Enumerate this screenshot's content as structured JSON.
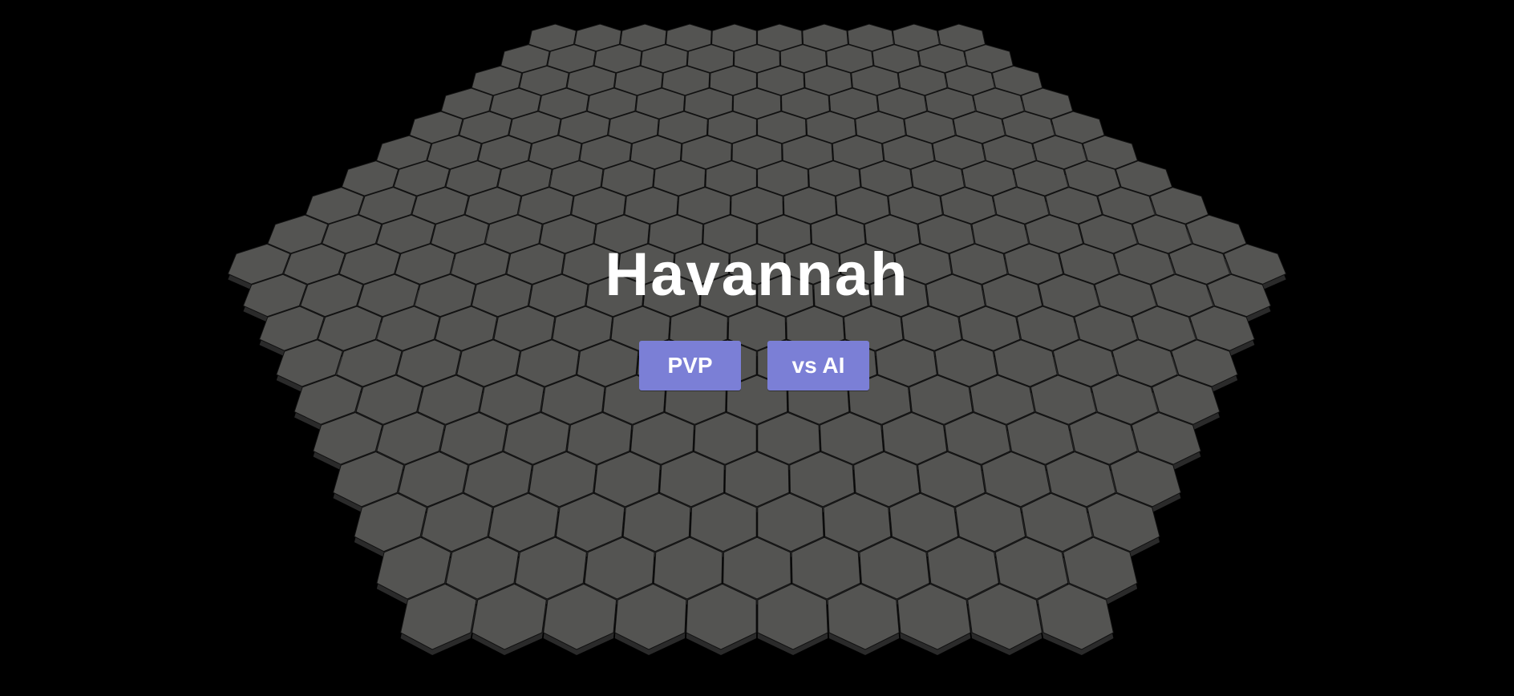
{
  "game": {
    "title": "Havannah",
    "board": {
      "shape": "hexagonal hex-tile board",
      "tile_color": "#545452",
      "tile_side_color": "#2a2a2a",
      "border_color": "#111111"
    }
  },
  "menu": {
    "buttons": [
      {
        "id": "pvp",
        "label": "PVP"
      },
      {
        "id": "ai",
        "label": "vs AI"
      }
    ],
    "button_color": "#7b7fd6"
  },
  "theme": {
    "background": "#000000",
    "title_color": "#ffffff"
  }
}
